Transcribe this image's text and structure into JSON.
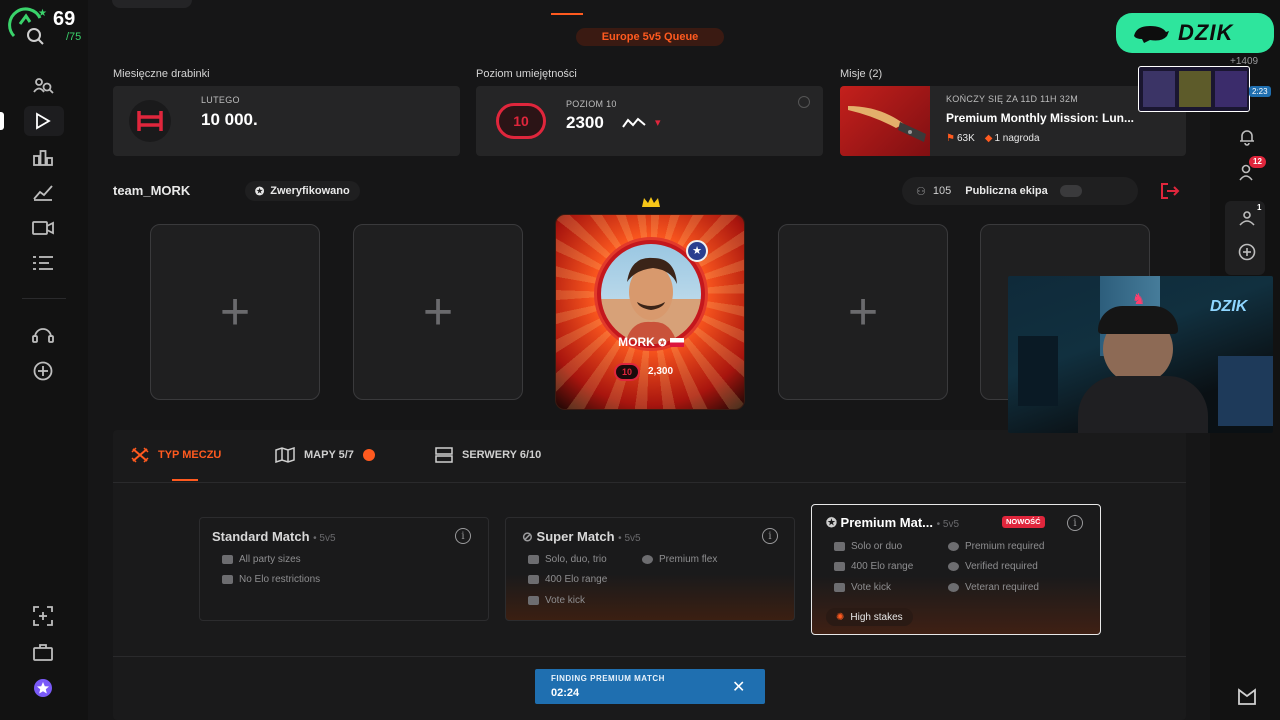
{
  "profile": {
    "level": "69",
    "progress": "/75"
  },
  "header": {
    "queue_label": "Europe 5v5 Queue"
  },
  "stats": {
    "ladder": {
      "section": "Miesięczne drabinki",
      "month": "LUTEGO",
      "value": "10 000."
    },
    "skill": {
      "section": "Poziom umiejętności",
      "level_label": "POZIOM 10",
      "elo": "2300",
      "level_badge": "10"
    },
    "missions": {
      "section": "Misje (2)",
      "ends": "KOŃCZY SIĘ ZA 11D 11H 32M",
      "title": "Premium Monthly Mission: Lun...",
      "points": "63K",
      "reward": "1 nagroda"
    }
  },
  "party": {
    "team_name": "team_MORK",
    "verified_label": "Zweryfikowano",
    "member_count": "105",
    "public_label": "Publiczna ekipa",
    "player": {
      "name": "MORK",
      "elo": "2,300",
      "level": "10"
    }
  },
  "tabs": [
    {
      "label": "TYP MECZU",
      "icon": "crossed-swords-icon"
    },
    {
      "label": "MAPY 5/7",
      "icon": "map-icon"
    },
    {
      "label": "SERWERY 6/10",
      "icon": "server-icon"
    }
  ],
  "matches": {
    "standard": {
      "title": "Standard Match",
      "mode": "• 5v5",
      "features": [
        "All party sizes",
        "No Elo restrictions"
      ]
    },
    "super": {
      "title": "Super Match",
      "mode": "• 5v5",
      "features": [
        "Solo, duo, trio",
        "Premium flex",
        "400 Elo range",
        "Vote kick"
      ]
    },
    "premium": {
      "title": "Premium Mat...",
      "mode": "• 5v5",
      "badge": "NOWOŚĆ",
      "features": [
        "Solo or duo",
        "Premium required",
        "400 Elo range",
        "Verified required",
        "Vote kick",
        "Veteran required"
      ],
      "stakes": "High stakes"
    }
  },
  "finding": {
    "label": "FINDING PREMIUM MATCH",
    "timer": "02:24"
  },
  "right_rail": {
    "points": "+1409",
    "time_badge": "2:23",
    "friends_badge": "12",
    "party_badge": "1"
  },
  "stream": {
    "brand": "DZIK",
    "webcam_brand": "DZIK"
  },
  "colors": {
    "accent": "#ff5a1f",
    "red": "#e0263c",
    "green": "#2ee59d",
    "blue": "#1f6fb0"
  }
}
